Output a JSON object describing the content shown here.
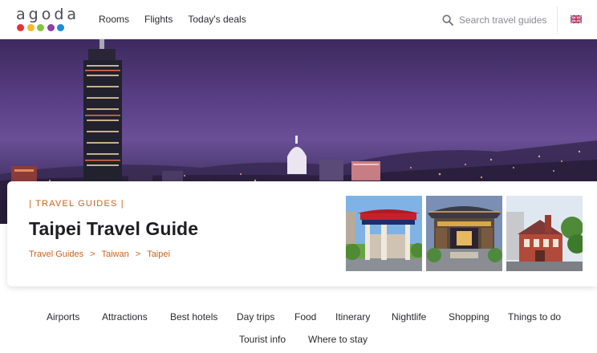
{
  "header": {
    "logo_text": "agoda",
    "logo_dot_colors": [
      "#e8303b",
      "#f4b92f",
      "#84c341",
      "#8b3fa1",
      "#1f8ad6"
    ],
    "nav": [
      {
        "label": "Rooms"
      },
      {
        "label": "Flights"
      },
      {
        "label": "Today's deals"
      }
    ],
    "search": {
      "placeholder": "Search travel guides",
      "value": "",
      "icon": "search-icon"
    },
    "language_flag": "uk-flag-icon"
  },
  "hero": {
    "image": "taipei-night-skyline"
  },
  "card": {
    "eyebrow_bar_left": "|",
    "eyebrow_label": "TRAVEL GUIDES",
    "eyebrow_bar_right": "|",
    "title": "Taipei Travel Guide",
    "breadcrumb": [
      {
        "label": "Travel Guides"
      },
      {
        "label": "Taiwan"
      },
      {
        "label": "Taipei"
      }
    ],
    "breadcrumb_separator": ">",
    "thumbnails": [
      "memorial-gate-photo",
      "temple-photo",
      "red-brick-building-photo"
    ]
  },
  "topics": {
    "row1": [
      {
        "label": "Airports"
      },
      {
        "label": "Attractions"
      },
      {
        "label": "Best hotels"
      },
      {
        "label": "Day trips"
      },
      {
        "label": "Food"
      },
      {
        "label": "Itinerary"
      },
      {
        "label": "Nightlife"
      },
      {
        "label": "Shopping"
      },
      {
        "label": "Things to do"
      }
    ],
    "row2": [
      {
        "label": "Tourist info"
      },
      {
        "label": "Where to stay"
      }
    ]
  },
  "colors": {
    "accent_orange": "#c9631c",
    "text_dark": "#2a2a2e"
  }
}
